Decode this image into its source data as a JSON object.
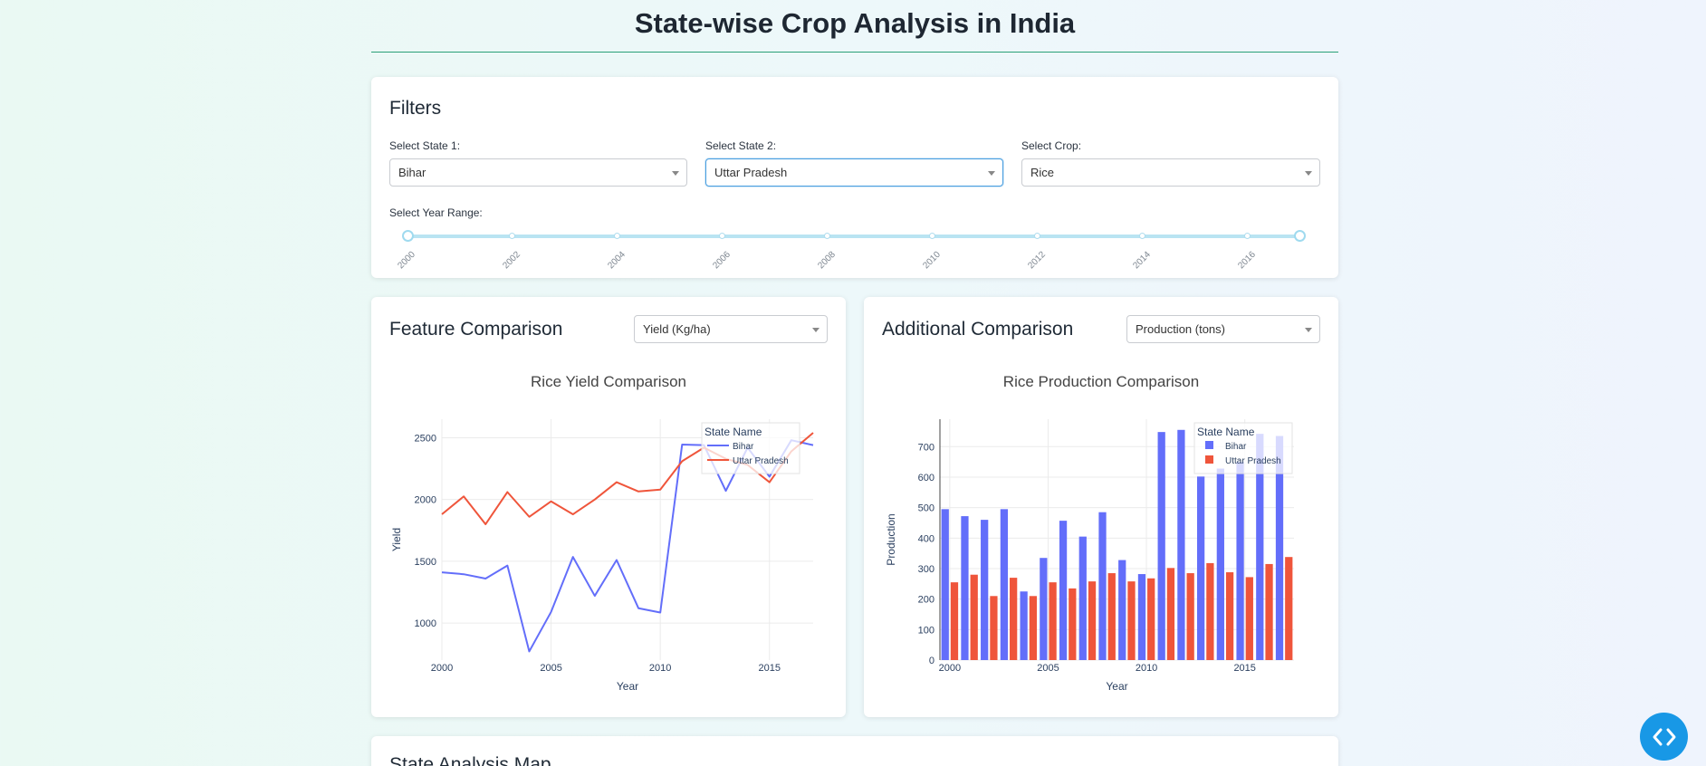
{
  "page": {
    "title": "State-wise Crop Analysis in India"
  },
  "filters": {
    "heading": "Filters",
    "state1": {
      "label": "Select State 1:",
      "value": "Bihar"
    },
    "state2": {
      "label": "Select State 2:",
      "value": "Uttar Pradesh"
    },
    "crop": {
      "label": "Select Crop:",
      "value": "Rice"
    },
    "year_range": {
      "label": "Select Year Range:",
      "marks": [
        "2000",
        "2002",
        "2004",
        "2006",
        "2008",
        "2010",
        "2012",
        "2014",
        "2016"
      ],
      "min": 2000,
      "max": 2017,
      "selected": [
        2000,
        2017
      ]
    }
  },
  "feature_card": {
    "heading": "Feature Comparison",
    "dropdown_value": "Yield (Kg/ha)"
  },
  "additional_card": {
    "heading": "Additional Comparison",
    "dropdown_value": "Production (tons)"
  },
  "map_card": {
    "heading": "State Analysis Map"
  },
  "colors": {
    "series1": "#636efa",
    "series2": "#ef553b",
    "accent": "#1898e6"
  },
  "icons": {
    "fab": "code-icon",
    "caret": "chevron-down-icon"
  },
  "chart_data": [
    {
      "type": "line",
      "title": "Rice Yield Comparison",
      "xlabel": "Year",
      "ylabel": "Yield",
      "legend_title": "State Name",
      "legend_position": "top-right",
      "x": [
        2000,
        2001,
        2002,
        2003,
        2004,
        2005,
        2006,
        2007,
        2008,
        2009,
        2010,
        2011,
        2012,
        2013,
        2014,
        2015,
        2016,
        2017
      ],
      "xticks": [
        2000,
        2005,
        2010,
        2015
      ],
      "yticks": [
        1000,
        1500,
        2000,
        2500
      ],
      "xlim": [
        2000,
        2017
      ],
      "ylim": [
        700,
        2650
      ],
      "grid": true,
      "series": [
        {
          "name": "Bihar",
          "values": [
            1410,
            1395,
            1360,
            1465,
            770,
            1090,
            1535,
            1220,
            1510,
            1120,
            1085,
            2445,
            2440,
            2070,
            2420,
            2185,
            2480,
            2440
          ]
        },
        {
          "name": "Uttar Pradesh",
          "values": [
            1880,
            2025,
            1800,
            2060,
            1860,
            1985,
            1880,
            2000,
            2140,
            2065,
            2080,
            2310,
            2420,
            2330,
            2280,
            2140,
            2390,
            2540
          ]
        }
      ]
    },
    {
      "type": "bar",
      "title": "Rice Production Comparison",
      "xlabel": "Year",
      "ylabel": "Production",
      "legend_title": "State Name",
      "legend_position": "top-right",
      "x": [
        2000,
        2001,
        2002,
        2003,
        2004,
        2005,
        2006,
        2007,
        2008,
        2009,
        2010,
        2011,
        2012,
        2013,
        2014,
        2015,
        2016,
        2017
      ],
      "xticks": [
        2000,
        2005,
        2010,
        2015
      ],
      "yticks": [
        0,
        100,
        200,
        300,
        400,
        500,
        600,
        700
      ],
      "xlim": [
        2000,
        2017
      ],
      "ylim": [
        0,
        790
      ],
      "grid": true,
      "series": [
        {
          "name": "Bihar",
          "values": [
            495,
            472,
            460,
            495,
            225,
            335,
            457,
            405,
            485,
            328,
            282,
            748,
            755,
            602,
            628,
            650,
            742,
            735
          ]
        },
        {
          "name": "Uttar Pradesh",
          "values": [
            255,
            280,
            210,
            270,
            210,
            255,
            235,
            258,
            285,
            258,
            268,
            302,
            285,
            318,
            288,
            272,
            315,
            338
          ]
        }
      ]
    }
  ]
}
